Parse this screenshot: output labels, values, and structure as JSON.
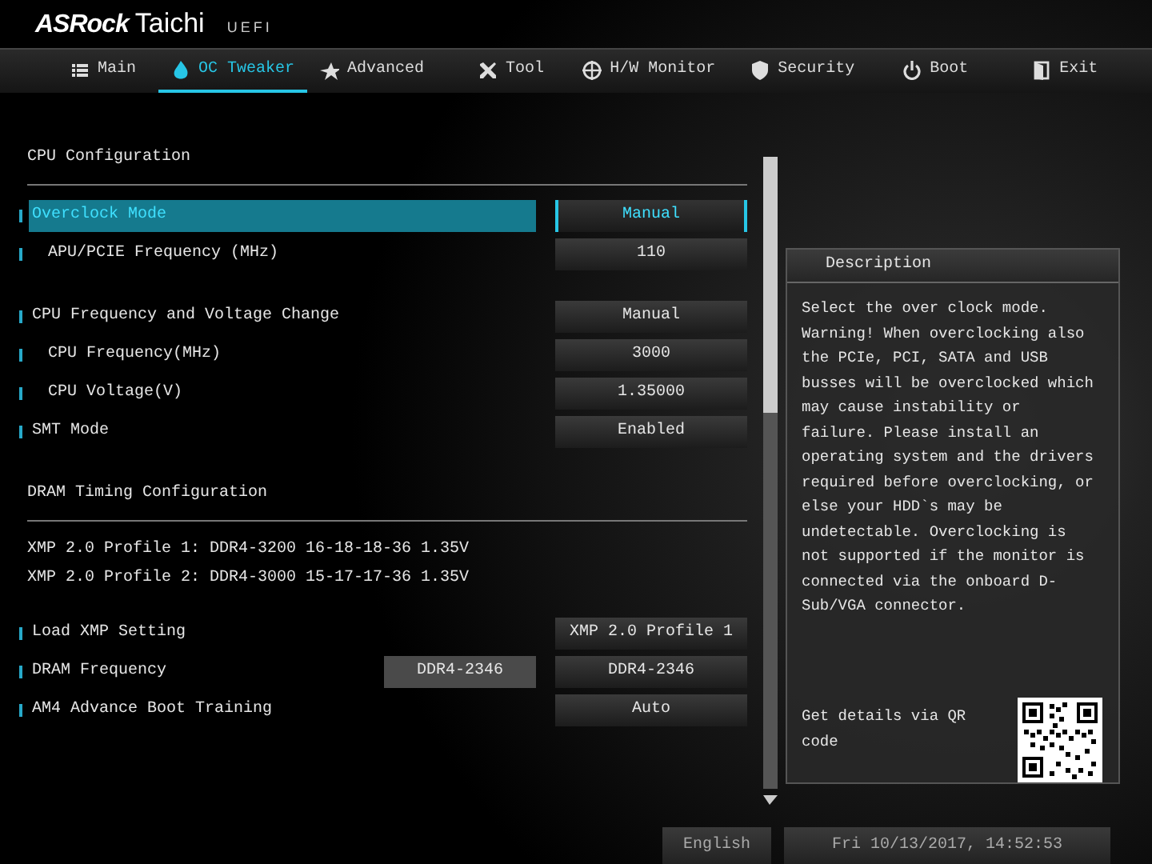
{
  "logo": {
    "brand": "ASRock",
    "model": "Taichi",
    "suffix": "UEFI"
  },
  "tabs": [
    {
      "label": "Main",
      "selected": false
    },
    {
      "label": "OC Tweaker",
      "selected": true
    },
    {
      "label": "Advanced",
      "selected": false
    },
    {
      "label": "Tool",
      "selected": false
    },
    {
      "label": "H/W Monitor",
      "selected": false
    },
    {
      "label": "Security",
      "selected": false
    },
    {
      "label": "Boot",
      "selected": false
    },
    {
      "label": "Exit",
      "selected": false
    }
  ],
  "settings": [
    {
      "kind": "section",
      "label": "CPU Configuration"
    },
    {
      "kind": "setting",
      "label": "Overclock Mode",
      "value": "Manual",
      "selected": true,
      "children": [
        {
          "kind": "setting",
          "label": "APU/PCIE Frequency (MHz)",
          "value": "110",
          "selected": false
        }
      ]
    },
    {
      "kind": "spacer"
    },
    {
      "kind": "setting",
      "label": "CPU Frequency and Voltage Change",
      "value": "Manual",
      "selected": false,
      "children": [
        {
          "kind": "setting",
          "label": "CPU Frequency(MHz)",
          "value": "3000",
          "selected": false
        },
        {
          "kind": "setting",
          "label": "CPU Voltage(V)",
          "value": "1.35000",
          "selected": false
        }
      ]
    },
    {
      "kind": "setting",
      "label": "SMT Mode",
      "value": "Enabled",
      "selected": false
    },
    {
      "kind": "section",
      "label": "DRAM Timing Configuration"
    },
    {
      "kind": "info",
      "label": "XMP 2.0 Profile 1: DDR4-3200 16-18-18-36 1.35V"
    },
    {
      "kind": "info",
      "label": "XMP 2.0 Profile 2: DDR4-3000 15-17-17-36 1.35V"
    },
    {
      "kind": "spacer"
    },
    {
      "kind": "setting",
      "label": "Load XMP Setting",
      "value": "XMP 2.0 Profile 1",
      "selected": false
    },
    {
      "kind": "setting",
      "label": "DRAM Frequency",
      "current": "DDR4-2346",
      "value": "DDR4-2346",
      "selected": false
    },
    {
      "kind": "setting",
      "label": "AM4 Advance Boot Training",
      "value": "Auto",
      "selected": false
    }
  ],
  "description": {
    "title": "Description",
    "text": "Select the over clock mode. Warning! When overclocking also the PCIe, PCI, SATA and USB busses will be overclocked which may cause instability or failure. Please install an operating system and the drivers required before overclocking, or else your HDD`s may be undetectable. Overclocking is not supported if the monitor is connected via the onboard D-Sub/VGA connector.",
    "qr_text": "Get details via QR code"
  },
  "status_bar": {
    "language": "English",
    "datetime": "Fri 10/13/2017, 14:52:53"
  }
}
